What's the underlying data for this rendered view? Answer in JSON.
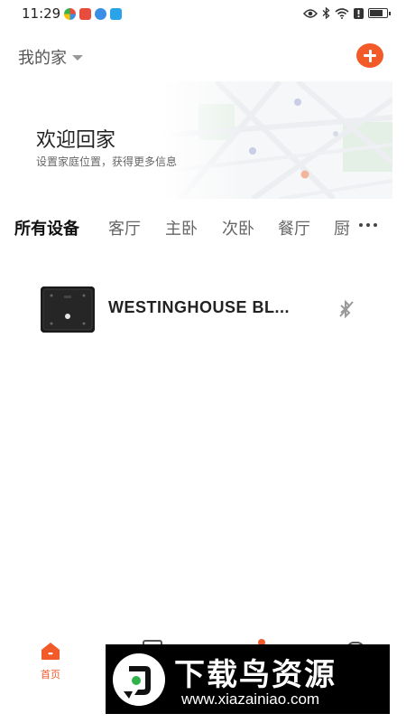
{
  "status_bar": {
    "time": "11:29",
    "app_icon_colors": [
      "#e84c3d",
      "#e84c3d",
      "#3a8ee6",
      "#2aa3e8"
    ],
    "battery_level": 0.8
  },
  "header": {
    "home_name": "我的家",
    "accent_color": "#f25a2a"
  },
  "welcome": {
    "title": "欢迎回家",
    "subtitle": "设置家庭位置，获得更多信息"
  },
  "tabs": [
    {
      "label": "所有设备",
      "active": true
    },
    {
      "label": "客厅",
      "active": false
    },
    {
      "label": "主卧",
      "active": false
    },
    {
      "label": "次卧",
      "active": false
    },
    {
      "label": "餐厅",
      "active": false
    },
    {
      "label": "厨",
      "active": false
    }
  ],
  "devices": [
    {
      "name": "WESTINGHOUSE BL...",
      "status_icon": "bluetooth-off-icon"
    }
  ],
  "bottom_nav": {
    "home_label": "首页"
  },
  "watermark": {
    "title": "下载鸟资源",
    "url": "www.xiazainiao.com"
  }
}
